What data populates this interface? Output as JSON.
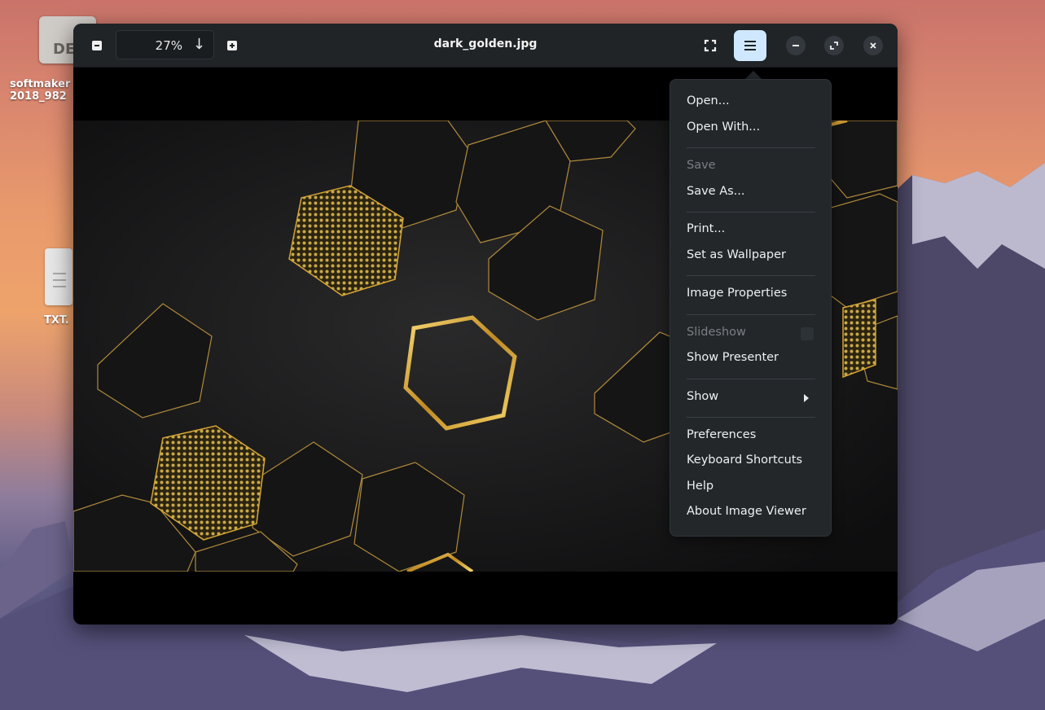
{
  "desktop": {
    "icons": [
      {
        "label_line1": "softmaker",
        "label_line2": "2018_982",
        "image_text": "DE"
      },
      {
        "label_line1": "TXT."
      }
    ]
  },
  "window": {
    "title": "dark_golden.jpg",
    "zoom": {
      "value": "27%",
      "arrow": "↓"
    }
  },
  "menu": {
    "items": [
      {
        "label": "Open...",
        "enabled": true
      },
      {
        "label": "Open With...",
        "enabled": true
      },
      {
        "label": "Save",
        "enabled": false
      },
      {
        "label": "Save As...",
        "enabled": true
      },
      {
        "label": "Print...",
        "enabled": true
      },
      {
        "label": "Set as Wallpaper",
        "enabled": true
      },
      {
        "label": "Image Properties",
        "enabled": true
      },
      {
        "label": "Slideshow",
        "enabled": false
      },
      {
        "label": "Show Presenter",
        "enabled": true
      },
      {
        "label": "Show",
        "enabled": true,
        "submenu": true
      },
      {
        "label": "Preferences",
        "enabled": true
      },
      {
        "label": "Keyboard Shortcuts",
        "enabled": true
      },
      {
        "label": "Help",
        "enabled": true
      },
      {
        "label": "About Image Viewer",
        "enabled": true
      }
    ]
  },
  "colors": {
    "headerbar": "#202427",
    "popover": "#23272a",
    "menu_button_active": "#cfe8ff",
    "gold": "#d4a437"
  }
}
